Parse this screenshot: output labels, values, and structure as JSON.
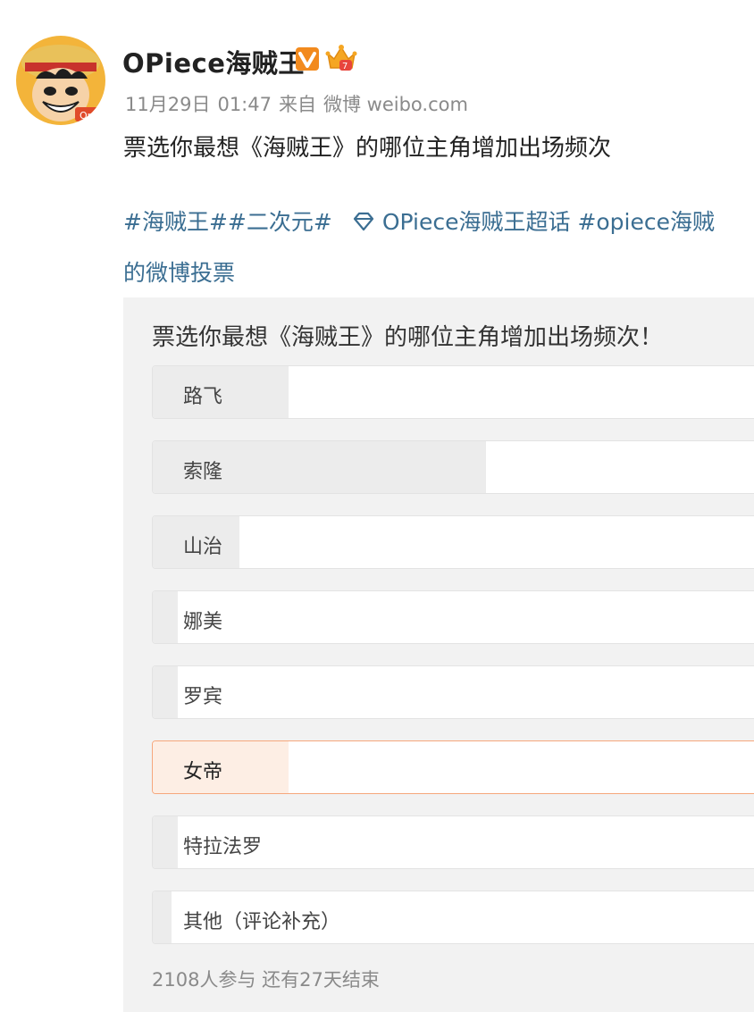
{
  "post": {
    "username": "OPiece海贼王",
    "date": "11月29日",
    "time": "01:47",
    "source_prefix": "来自",
    "source": "微博 weibo.com",
    "text": "票选你最想《海贼王》的哪位主角增加出场频次",
    "topics": [
      "#海贼王#",
      "#二次元#"
    ],
    "supertopic": "OPiece海贼王超话",
    "topic_tail": "#opiece海贼",
    "topic_line2": "的微博投票"
  },
  "poll": {
    "title": "票选你最想《海贼王》的哪位主角增加出场频次！",
    "options": [
      {
        "label": "路飞",
        "fill": 0.22,
        "selected": false
      },
      {
        "label": "索隆",
        "fill": 0.54,
        "selected": false
      },
      {
        "label": "山治",
        "fill": 0.14,
        "selected": false
      },
      {
        "label": "娜美",
        "fill": 0.04,
        "selected": false
      },
      {
        "label": "罗宾",
        "fill": 0.04,
        "selected": false
      },
      {
        "label": "女帝",
        "fill": 0.22,
        "selected": true
      },
      {
        "label": "特拉法罗",
        "fill": 0.04,
        "selected": false
      },
      {
        "label": "其他（评论补充）",
        "fill": 0.03,
        "selected": false
      }
    ],
    "participants": "2108人参与",
    "remaining": "还有27天结束"
  },
  "colors": {
    "link": "#3b6e92",
    "selected_border": "#f6a77c",
    "selected_fill": "#fdeee4",
    "badge": "#f2a33a"
  },
  "icons": {
    "avatar": "luffy-avatar",
    "verified": "verified-v-icon",
    "vip": "crown-vip-icon",
    "supertopic": "diamond-supertopic-icon"
  }
}
